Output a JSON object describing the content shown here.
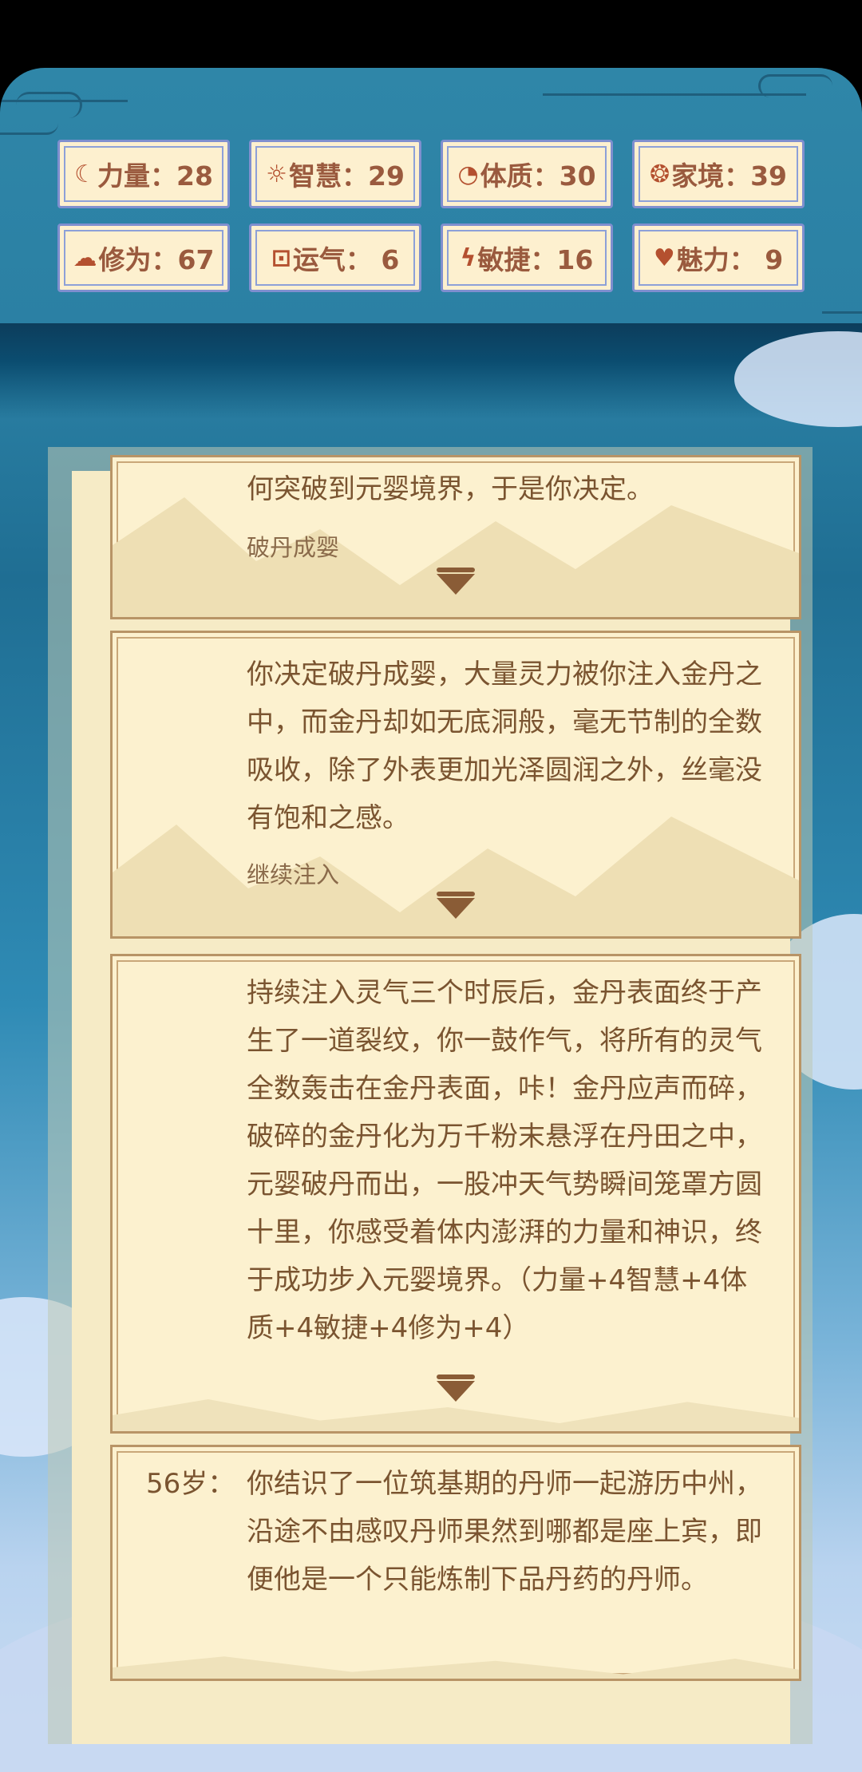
{
  "stats": [
    {
      "icon": "strength-icon",
      "glyph": "☾",
      "label": "力量：28"
    },
    {
      "icon": "wisdom-icon",
      "glyph": "☼",
      "label": "智慧：29"
    },
    {
      "icon": "constitution-icon",
      "glyph": "◔",
      "label": "体质：30"
    },
    {
      "icon": "family-icon",
      "glyph": "❂",
      "label": "家境：39"
    },
    {
      "icon": "cultivation-icon",
      "glyph": "☁",
      "label": "修为：67"
    },
    {
      "icon": "luck-icon",
      "glyph": "⊡",
      "label": "运气： 6"
    },
    {
      "icon": "agility-icon",
      "glyph": "ϟ",
      "label": "敏捷：16"
    },
    {
      "icon": "charm-icon",
      "glyph": "♥",
      "label": "魅力： 9"
    }
  ],
  "events": [
    {
      "text": "何突破到元婴境界，于是你决定。",
      "choice": "破丹成婴"
    },
    {
      "text": "你决定破丹成婴，大量灵力被你注入金丹之中，而金丹却如无底洞般，毫无节制的全数吸收，除了外表更加光泽圆润之外，丝毫没有饱和之感。",
      "choice": "继续注入"
    },
    {
      "text": "持续注入灵气三个时辰后，金丹表面终于产生了一道裂纹，你一鼓作气，将所有的灵气全数轰击在金丹表面，咔！金丹应声而碎，破碎的金丹化为万千粉末悬浮在丹田之中，元婴破丹而出，一股冲天气势瞬间笼罩方圆十里，你感受着体内澎湃的力量和神识，终于成功步入元婴境界。（力量+4智慧+4体质+4敏捷+4修为+4）"
    },
    {
      "age": "56岁：",
      "text": "你结识了一位筑基期的丹师一起游历中州，沿途不由感叹丹师果然到哪都是座上宾，即便他是一个只能炼制下品丹药的丹师。"
    }
  ]
}
